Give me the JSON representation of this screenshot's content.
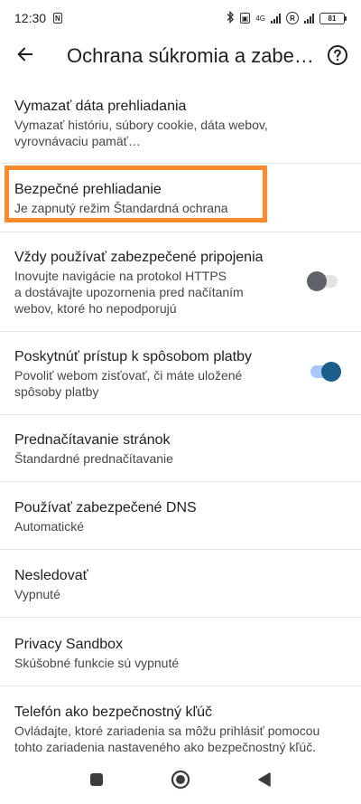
{
  "status_bar": {
    "time": "12:30",
    "network_label": "4G",
    "signal_extra": "R",
    "battery_level": "81"
  },
  "app_bar": {
    "title": "Ochrana súkromia a zabezpečenie"
  },
  "items": [
    {
      "title": "Vymazať dáta prehliadania",
      "subtitle_lines": [
        "Vymazať históriu, súbory cookie, dáta webov,",
        "vyrovnávaciu pamäť…"
      ]
    },
    {
      "title": "Bezpečné prehliadanie",
      "subtitle_lines": [
        "Je zapnutý režim Štandardná ochrana"
      ]
    },
    {
      "title": "Vždy používať zabezpečené pripojenia",
      "subtitle_lines": [
        "Inovujte navigácie na protokol HTTPS",
        "a dostávajte upozornenia pred načítaním",
        "webov, ktoré ho nepodporujú"
      ],
      "toggle": "off"
    },
    {
      "title": "Poskytnúť prístup k spôsobom platby",
      "subtitle_lines": [
        "Povoliť webom zisťovať, či máte uložené",
        "spôsoby platby"
      ],
      "toggle": "on"
    },
    {
      "title": "Prednačítavanie stránok",
      "subtitle_lines": [
        "Štandardné prednačítavanie"
      ]
    },
    {
      "title": "Používať zabezpečené DNS",
      "subtitle_lines": [
        "Automatické"
      ]
    },
    {
      "title": "Nesledovať",
      "subtitle_lines": [
        "Vypnuté"
      ]
    },
    {
      "title": "Privacy Sandbox",
      "subtitle_lines": [
        "Skúšobné funkcie sú vypnuté"
      ]
    },
    {
      "title": "Telefón ako bezpečnostný kľúč",
      "subtitle_lines": [
        "Ovládajte, ktoré zariadenia sa môžu prihlásiť pomocou",
        "tohto zariadenia nastaveného ako bezpečnostný kľúč."
      ]
    }
  ],
  "colors": {
    "highlight": "#ff8a2b",
    "toggle_on": "#1b5e8a",
    "toggle_off": "#5f6368"
  },
  "icons": {
    "back": "arrow-left-icon",
    "help": "help-circle-icon",
    "nav_recents": "square-icon",
    "nav_home": "circle-icon",
    "nav_back": "triangle-back-icon"
  }
}
